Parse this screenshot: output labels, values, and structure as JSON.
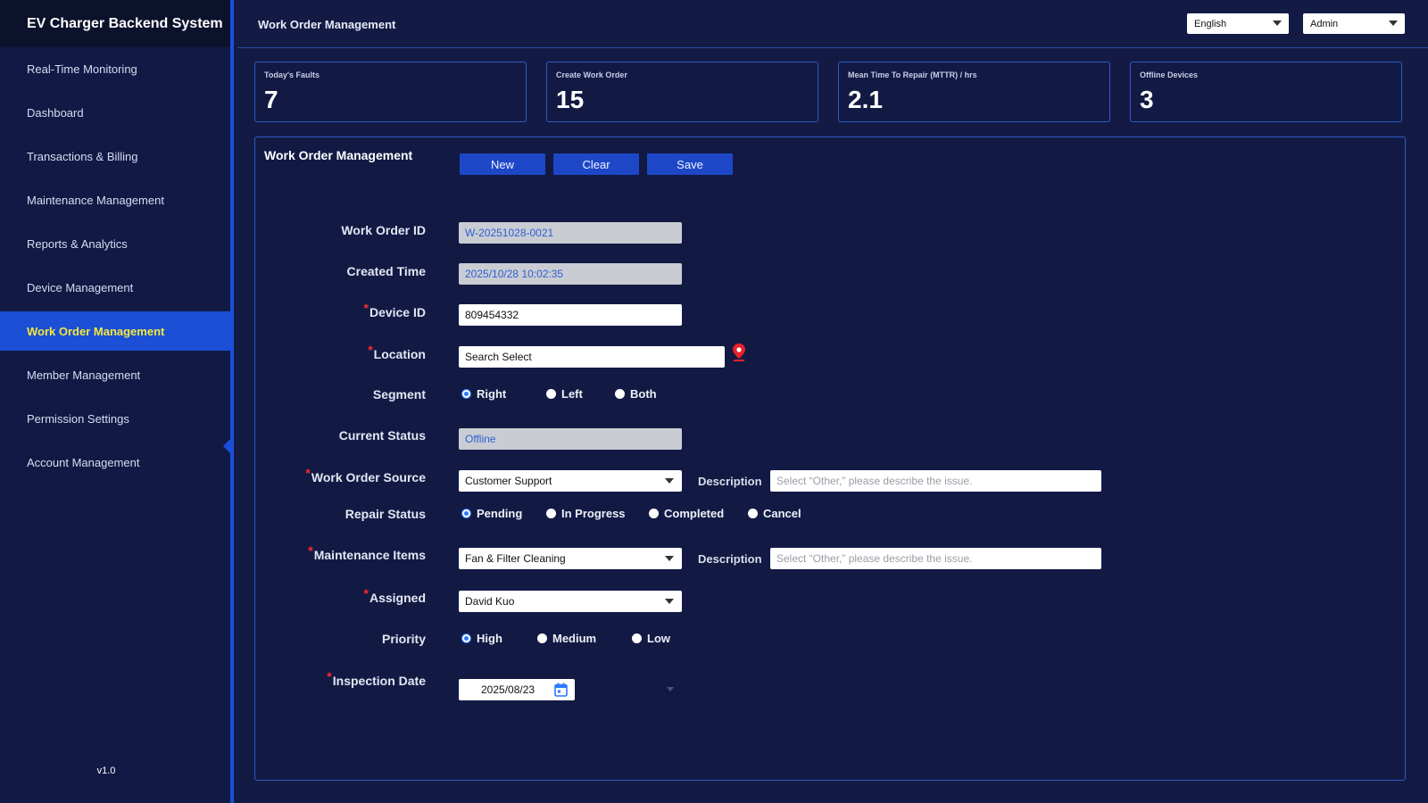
{
  "app": {
    "title": "EV Charger Backend System",
    "version": "v1.0"
  },
  "sidebar": {
    "items": [
      {
        "label": "Real-Time Monitoring"
      },
      {
        "label": "Dashboard"
      },
      {
        "label": "Transactions & Billing"
      },
      {
        "label": "Maintenance Management"
      },
      {
        "label": "Reports & Analytics"
      },
      {
        "label": "Device Management"
      },
      {
        "label": "Work Order Management",
        "active": true
      },
      {
        "label": "Member Management"
      },
      {
        "label": "Permission Settings"
      },
      {
        "label": "Account Management"
      }
    ]
  },
  "header": {
    "title": "Work Order Management",
    "language": "English",
    "user": "Admin"
  },
  "kpis": [
    {
      "label": "Today's Faults",
      "value": "7"
    },
    {
      "label": "Create Work Order",
      "value": "15"
    },
    {
      "label": "Mean Time To Repair (MTTR) / hrs",
      "value": "2.1"
    },
    {
      "label": "Offline Devices",
      "value": "3"
    }
  ],
  "panel": {
    "title": "Work Order Management",
    "buttons": {
      "new": "New",
      "clear": "Clear",
      "save": "Save"
    }
  },
  "form": {
    "work_order_id": {
      "label": "Work Order ID",
      "value": "W-20251028-0021"
    },
    "created_time": {
      "label": "Created Time",
      "value": "2025/10/28 10:02:35"
    },
    "device_id": {
      "label": "Device ID",
      "value": "809454332",
      "required": "*"
    },
    "location": {
      "label": "Location",
      "value": "Search Select",
      "required": "*"
    },
    "segment": {
      "label": "Segment",
      "options": [
        "Right",
        "Left",
        "Both"
      ],
      "selected": "Right"
    },
    "current_status": {
      "label": "Current Status",
      "value": "Offline"
    },
    "work_order_source": {
      "label": "Work Order Source",
      "value": "Customer Support",
      "required": "*",
      "desc_label": "Description",
      "desc_placeholder": "Select “Other,” please describe the issue."
    },
    "repair_status": {
      "label": "Repair Status",
      "options": [
        "Pending",
        "In Progress",
        "Completed",
        "Cancel"
      ],
      "selected": "Pending"
    },
    "maintenance_items": {
      "label": "Maintenance Items",
      "value": "Fan & Filter Cleaning",
      "required": "*",
      "desc_label": "Description",
      "desc_placeholder": "Select “Other,” please describe the issue."
    },
    "assigned": {
      "label": "Assigned",
      "value": "David Kuo",
      "required": "*"
    },
    "priority": {
      "label": "Priority",
      "options": [
        "High",
        "Medium",
        "Low"
      ],
      "selected": "High"
    },
    "inspection_date": {
      "label": "Inspection Date",
      "value": "2025/08/23",
      "required": "*"
    }
  },
  "colors": {
    "background": "#131b45",
    "accent": "#1b4fd6",
    "active_text": "#f5e83a",
    "required": "#ff2a2a",
    "radio": "#2d78ff"
  }
}
